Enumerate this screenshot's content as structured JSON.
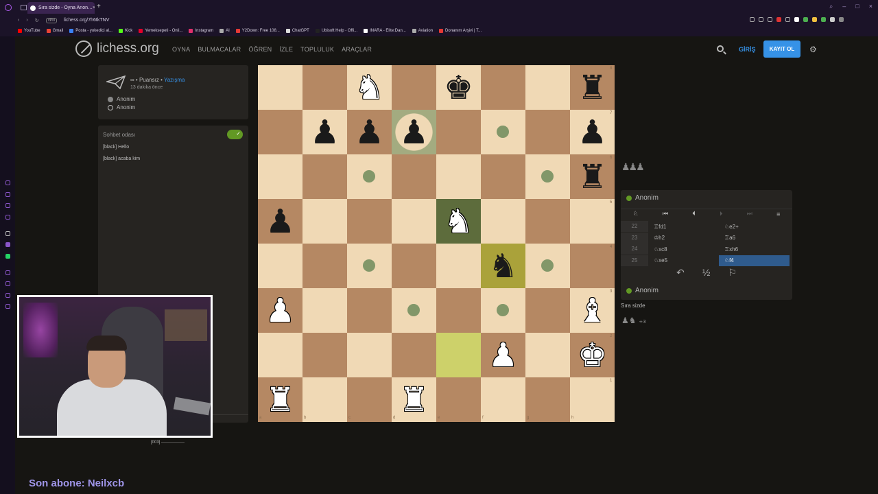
{
  "browser": {
    "tab_title": "Sıra sizde - Oyna Anon…",
    "url": "lichess.org/7h6tkTNV",
    "url_badge": "VPN",
    "bookmarks": [
      {
        "label": "YouTube",
        "color": "#ff0000"
      },
      {
        "label": "Gmail",
        "color": "#ea4335"
      },
      {
        "label": "Posta - yokedici al...",
        "color": "#3b82f6"
      },
      {
        "label": "Kick",
        "color": "#53fc18"
      },
      {
        "label": "Yemeksepeti - Onli...",
        "color": "#e4002b"
      },
      {
        "label": "Instagram",
        "color": "#e1306c"
      },
      {
        "label": "AI",
        "color": "#aaaaaa"
      },
      {
        "label": "Y2Down: Free 108...",
        "color": "#e53935"
      },
      {
        "label": "ChatGPT",
        "color": "#dddddd"
      },
      {
        "label": "Ubisoft Help - Offi...",
        "color": "#222222"
      },
      {
        "label": "INARA - Elite:Dan...",
        "color": "#ffffff"
      },
      {
        "label": "Aviation",
        "color": "#aaaaaa"
      },
      {
        "label": "Donanım Arşivi | T...",
        "color": "#e53935"
      }
    ]
  },
  "header": {
    "brand": "lichess.org",
    "nav": [
      "OYNA",
      "BULMACALAR",
      "ÖĞREN",
      "İZLE",
      "TOPLULUK",
      "ARAÇLAR"
    ],
    "login": "GİRİŞ",
    "signup": "KAYIT OL"
  },
  "game": {
    "meta_prefix": "∞ • Puansız • ",
    "meta_link": "Yazışma",
    "ago": "13 dakika önce",
    "players": [
      "Anonim",
      "Anonim"
    ]
  },
  "chat": {
    "title": "Sohbet odası",
    "messages": [
      "[black] Hello",
      "[black] acaba kim"
    ]
  },
  "board": {
    "files": [
      "a",
      "b",
      "c",
      "d",
      "e",
      "f",
      "g",
      "h"
    ],
    "ranks": [
      "8",
      "7",
      "6",
      "5",
      "4",
      "3",
      "2",
      "1"
    ],
    "pieces": [
      {
        "sq": "c8",
        "glyph": "♞",
        "color": "white"
      },
      {
        "sq": "e8",
        "glyph": "♚",
        "color": "black"
      },
      {
        "sq": "h8",
        "glyph": "♜",
        "color": "black"
      },
      {
        "sq": "b7",
        "glyph": "♟",
        "color": "black"
      },
      {
        "sq": "c7",
        "glyph": "♟",
        "color": "black"
      },
      {
        "sq": "d7",
        "glyph": "♟",
        "color": "black"
      },
      {
        "sq": "h7",
        "glyph": "♟",
        "color": "black"
      },
      {
        "sq": "h6",
        "glyph": "♜",
        "color": "black"
      },
      {
        "sq": "a5",
        "glyph": "♟",
        "color": "black"
      },
      {
        "sq": "e5",
        "glyph": "♞",
        "color": "white"
      },
      {
        "sq": "f4",
        "glyph": "♞",
        "color": "black"
      },
      {
        "sq": "a3",
        "glyph": "♟",
        "color": "white"
      },
      {
        "sq": "h3",
        "glyph": "♝",
        "color": "white"
      },
      {
        "sq": "f2",
        "glyph": "♟",
        "color": "white"
      },
      {
        "sq": "h2",
        "glyph": "♚",
        "color": "white"
      },
      {
        "sq": "a1",
        "glyph": "♜",
        "color": "white"
      },
      {
        "sq": "d1",
        "glyph": "♜",
        "color": "white"
      }
    ],
    "dots": [
      "f7",
      "c6",
      "g6",
      "c4",
      "g4",
      "d3",
      "f3"
    ],
    "selected": "e5",
    "last_move": [
      "e2",
      "f4"
    ],
    "check_ring": "d7"
  },
  "right": {
    "captured": "♟♟♟",
    "opponent": "Anonim",
    "moves": [
      {
        "n": "22",
        "w": "♖fd1",
        "b": "♘e2+"
      },
      {
        "n": "23",
        "w": "♔h2",
        "b": "♖a6"
      },
      {
        "n": "24",
        "w": "♘xc8",
        "b": "♖xh6"
      },
      {
        "n": "25",
        "w": "♘xe5",
        "b": "♘f4"
      }
    ],
    "player": "Anonim",
    "your_turn": "Sıra sizde",
    "material": "♟♞",
    "material_diff": "+3"
  },
  "stream": {
    "cam_label": "[003] -----------------",
    "last_sub": "Son abone: Neilxcb"
  },
  "colors": {
    "board_light": "#f0d9b5",
    "board_dark": "#b58863",
    "accent": "#3692e7",
    "online": "#629924"
  }
}
